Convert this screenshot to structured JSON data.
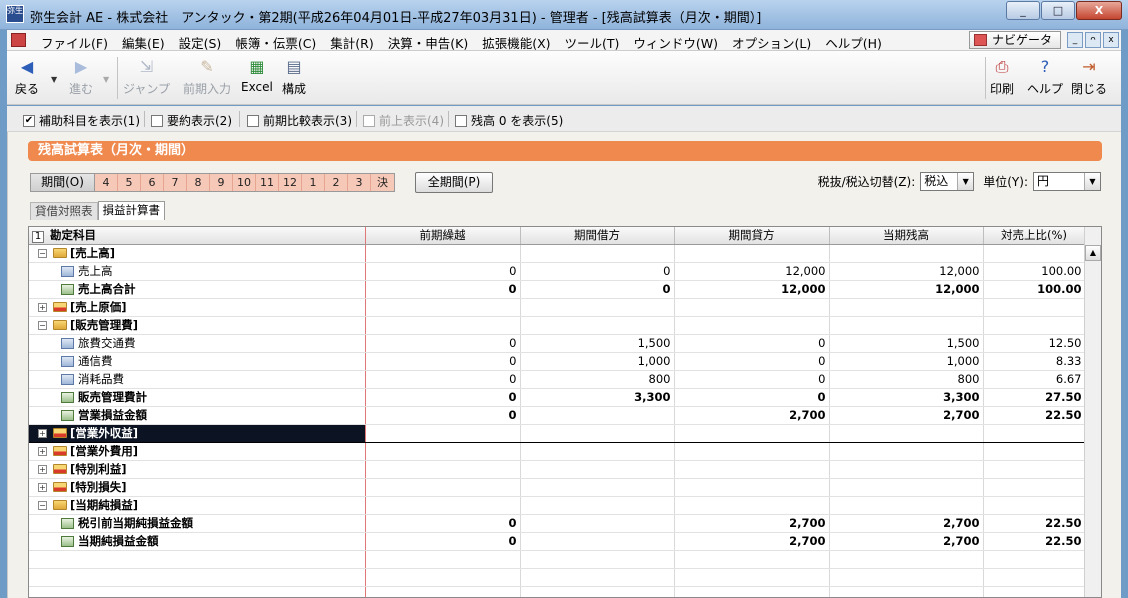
{
  "window": {
    "icon_text": "弥生",
    "title": "弥生会計 AE - 株式会社　アンタック・第2期(平成26年04月01日-平成27年03月31日) - 管理者 - [残高試算表（月次・期間）]",
    "min": "_",
    "max": "□",
    "close": "X"
  },
  "menu": {
    "items": [
      "ファイル(F)",
      "編集(E)",
      "設定(S)",
      "帳簿・伝票(C)",
      "集計(R)",
      "決算・申告(K)",
      "拡張機能(X)",
      "ツール(T)",
      "ウィンドウ(W)",
      "オプション(L)",
      "ヘルプ(H)"
    ],
    "navigator": "ナビゲータ",
    "mdi": [
      "_",
      "ᴖ",
      "x"
    ]
  },
  "toolbar": {
    "back": "戻る",
    "forward": "進む",
    "jump": "ジャンプ",
    "prev_input": "前期入力",
    "excel": "Excel",
    "compose": "構成",
    "print": "印刷",
    "help": "ヘルプ",
    "close": "閉じる"
  },
  "options": [
    {
      "label": "補助科目を表示(1)",
      "checked": true
    },
    {
      "label": "要約表示(2)",
      "checked": false
    },
    {
      "label": "前期比較表示(3)",
      "checked": false
    },
    {
      "label": "前上表示(4)",
      "checked": false
    },
    {
      "label": "残高 0 を表示(5)",
      "checked": false
    }
  ],
  "report_title": "残高試算表（月次・期間）",
  "period": {
    "label": "期間(O)",
    "months": [
      "4",
      "5",
      "6",
      "7",
      "8",
      "9",
      "10",
      "11",
      "12",
      "1",
      "2",
      "3",
      "決"
    ],
    "all_label": "全期間(P)"
  },
  "tax": {
    "label": "税抜/税込切替(Z):",
    "value": "税込",
    "unit_label": "単位(Y):",
    "unit_value": "円"
  },
  "tabs": [
    "貸借対照表",
    "損益計算書"
  ],
  "grid": {
    "head_num": "1",
    "columns": [
      "勘定科目",
      "前期繰越",
      "期間借方",
      "期間貸方",
      "当期残高",
      "対売上比(%)"
    ],
    "rows": [
      {
        "type": "group",
        "expanded": true,
        "label": "[売上高]",
        "values": [
          "",
          "",
          "",
          "",
          ""
        ]
      },
      {
        "type": "account",
        "label": "売上高",
        "values": [
          "0",
          "0",
          "12,000",
          "12,000",
          "100.00"
        ]
      },
      {
        "type": "sum",
        "label": "売上高合計",
        "values": [
          "0",
          "0",
          "12,000",
          "12,000",
          "100.00"
        ]
      },
      {
        "type": "group",
        "expanded": false,
        "label": "[売上原価]",
        "values": [
          "",
          "",
          "",
          "",
          ""
        ]
      },
      {
        "type": "group",
        "expanded": true,
        "label": "[販売管理費]",
        "values": [
          "",
          "",
          "",
          "",
          ""
        ]
      },
      {
        "type": "account",
        "label": "旅費交通費",
        "values": [
          "0",
          "1,500",
          "0",
          "1,500",
          "12.50"
        ]
      },
      {
        "type": "account",
        "label": "通信費",
        "values": [
          "0",
          "1,000",
          "0",
          "1,000",
          "8.33"
        ]
      },
      {
        "type": "account",
        "label": "消耗品費",
        "values": [
          "0",
          "800",
          "0",
          "800",
          "6.67"
        ]
      },
      {
        "type": "sum",
        "label": "販売管理費計",
        "values": [
          "0",
          "3,300",
          "0",
          "3,300",
          "27.50"
        ]
      },
      {
        "type": "sum",
        "label": "営業損益金額",
        "values": [
          "0",
          "",
          "2,700",
          "2,700",
          "22.50"
        ]
      },
      {
        "type": "group",
        "expanded": false,
        "selected": true,
        "label": "[営業外収益]",
        "values": [
          "",
          "",
          "",
          "",
          ""
        ]
      },
      {
        "type": "group",
        "expanded": false,
        "label": "[営業外費用]",
        "values": [
          "",
          "",
          "",
          "",
          ""
        ]
      },
      {
        "type": "group",
        "expanded": false,
        "label": "[特別利益]",
        "values": [
          "",
          "",
          "",
          "",
          ""
        ]
      },
      {
        "type": "group",
        "expanded": false,
        "label": "[特別損失]",
        "values": [
          "",
          "",
          "",
          "",
          ""
        ]
      },
      {
        "type": "group",
        "expanded": true,
        "label": "[当期純損益]",
        "values": [
          "",
          "",
          "",
          "",
          ""
        ]
      },
      {
        "type": "sum",
        "label": "税引前当期純損益金額",
        "values": [
          "0",
          "",
          "2,700",
          "2,700",
          "22.50"
        ]
      },
      {
        "type": "sum",
        "label": "当期純損益金額",
        "values": [
          "0",
          "",
          "2,700",
          "2,700",
          "22.50"
        ]
      }
    ]
  }
}
